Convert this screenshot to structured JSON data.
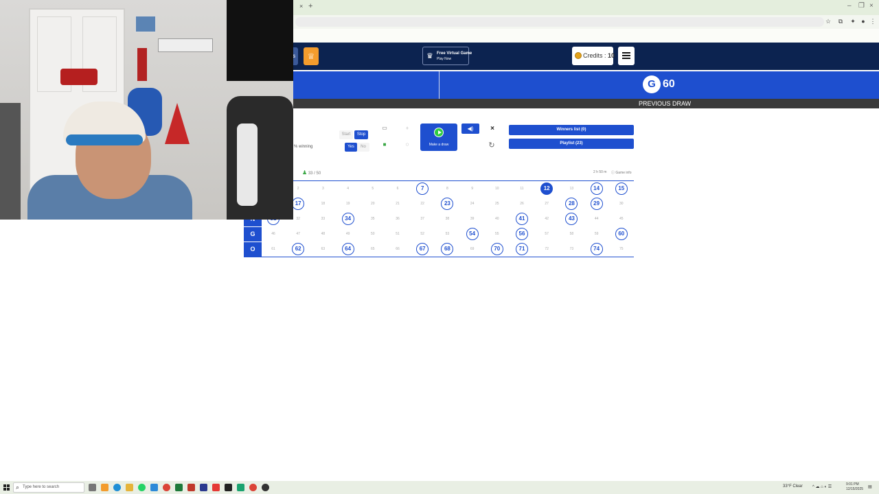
{
  "browser": {
    "tab_close": "×",
    "new_tab": "+",
    "window_controls": [
      "–",
      "❐",
      "×"
    ]
  },
  "header": {
    "free_game_line1": "Free Virtual Game",
    "free_game_line2": "Play Now",
    "credits_label": "Credits : ",
    "credits_value": "10"
  },
  "banner": {
    "previous_letter": "G",
    "previous_number": "60",
    "previous_draw_label": "PREVIOUS DRAW"
  },
  "controls": {
    "winning_label": "% winning",
    "start_label": "Start",
    "stop_label": "Stop",
    "yes_label": "Yes",
    "no_label": "No",
    "make_draw_label": "Make a draw",
    "winners_list_label": "Winners list (0)",
    "playlist_label": "Playlist (23)",
    "close_label": "×"
  },
  "board_info": {
    "players": "33 / 50",
    "timer": "2 h 50 m",
    "game_info": "Game info"
  },
  "board": {
    "letters": [
      "N",
      "G",
      "O"
    ],
    "current": 12,
    "drawn": [
      7,
      12,
      14,
      15,
      17,
      23,
      28,
      29,
      31,
      34,
      41,
      43,
      54,
      56,
      60,
      62,
      64,
      67,
      68,
      70,
      71,
      74
    ],
    "rows": [
      [
        2,
        3,
        4,
        5,
        6,
        7,
        8,
        9,
        10,
        11,
        12,
        13,
        14,
        15
      ],
      [
        17,
        18,
        19,
        20,
        21,
        22,
        23,
        24,
        25,
        26,
        27,
        28,
        29,
        30
      ],
      [
        31,
        32,
        33,
        34,
        35,
        36,
        37,
        38,
        39,
        40,
        41,
        42,
        43,
        44,
        45
      ],
      [
        46,
        47,
        48,
        49,
        50,
        51,
        52,
        53,
        54,
        55,
        56,
        57,
        58,
        59,
        60
      ],
      [
        61,
        62,
        63,
        64,
        65,
        66,
        67,
        68,
        69,
        70,
        71,
        72,
        73,
        74,
        75
      ]
    ]
  },
  "taskbar": {
    "search_placeholder": "Type here to search",
    "weather": "33°F Clear",
    "time": "9:01 PM",
    "date": "12/15/2025"
  },
  "colors": {
    "primary_blue": "#1e4fcf",
    "header_navy": "#0c2350",
    "orange_button": "#f39c2d",
    "play_green": "#2ecc40"
  }
}
